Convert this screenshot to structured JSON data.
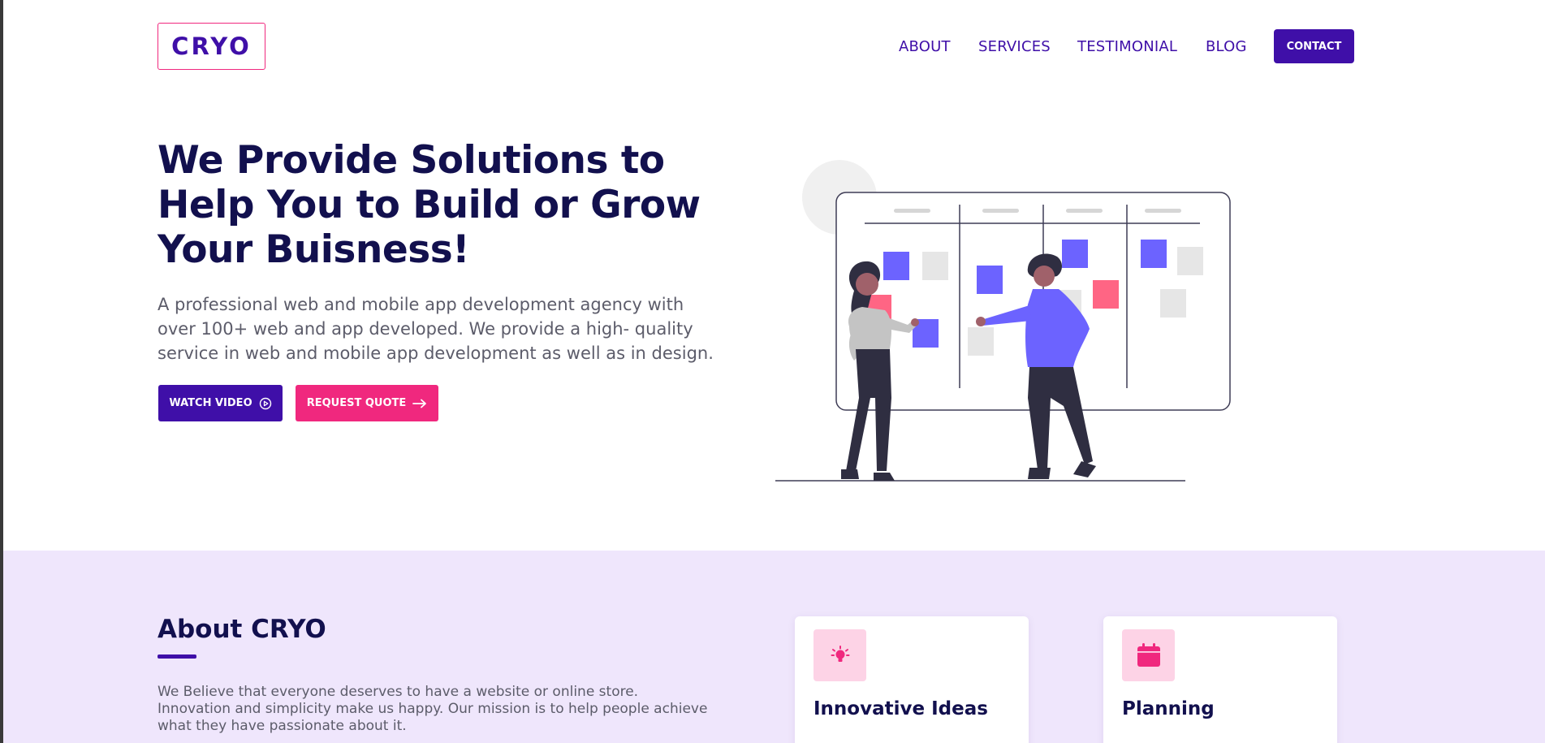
{
  "brand": {
    "logo": "CRYO"
  },
  "nav": {
    "items": [
      "ABOUT",
      "SERVICES",
      "TESTIMONIAL",
      "BLOG"
    ],
    "contact": "CONTACT"
  },
  "hero": {
    "title": "We Provide Solutions to Help You to Build or Grow Your Buisness!",
    "description": "A professional web and mobile app development agency with over 100+ web and app developed. We provide a high- quality service in web and mobile app development as well as in design.",
    "watch_video": "WATCH VIDEO",
    "watch_video_icon": "play-circle-icon",
    "request_quote": "REQUEST QUOTE",
    "request_quote_icon": "arrow-right-icon"
  },
  "about": {
    "title": "About CRYO",
    "text": "We Believe that everyone deserves to have a website or online store. Innovation and simplicity make us happy. Our mission is to help people achieve what they have passionate about it.",
    "cards": [
      {
        "title": "Innovative Ideas",
        "icon": "lightbulb-icon"
      },
      {
        "title": "Planning",
        "icon": "calendar-icon"
      }
    ]
  },
  "colors": {
    "primary": "#3f0fa8",
    "accent": "#f0287e",
    "heading": "#12104e",
    "section_bg": "#efe6fc",
    "icon_bg": "#fdd3e6"
  }
}
